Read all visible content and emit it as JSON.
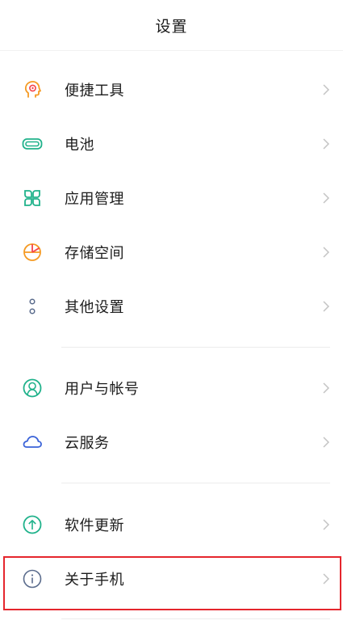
{
  "header": {
    "title": "设置"
  },
  "items": [
    {
      "label": "便捷工具",
      "icon": "head-tools-icon"
    },
    {
      "label": "电池",
      "icon": "battery-icon"
    },
    {
      "label": "应用管理",
      "icon": "app-grid-icon"
    },
    {
      "label": "存储空间",
      "icon": "storage-pie-icon"
    },
    {
      "label": "其他设置",
      "icon": "more-dots-icon"
    },
    {
      "label": "用户与帐号",
      "icon": "user-account-icon"
    },
    {
      "label": "云服务",
      "icon": "cloud-icon"
    },
    {
      "label": "软件更新",
      "icon": "update-arrow-icon"
    },
    {
      "label": "关于手机",
      "icon": "info-icon"
    }
  ],
  "colors": {
    "orange": "#f59a23",
    "green": "#20b28b",
    "blue": "#3a63d8",
    "grey": "#5a6b8c",
    "highlight": "#e5262d"
  }
}
